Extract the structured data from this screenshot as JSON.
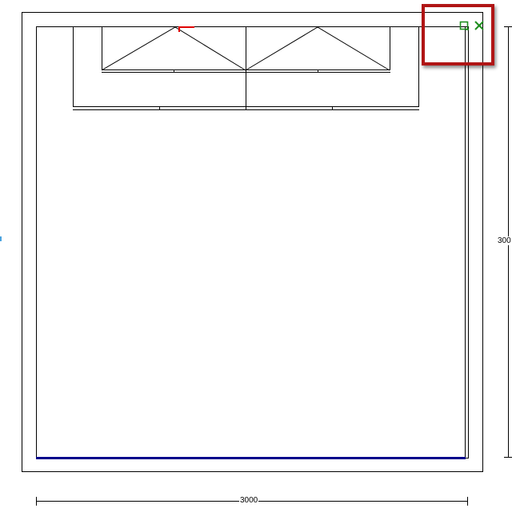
{
  "drawing": {
    "dimension_bottom": "3000",
    "dimension_right": "300"
  },
  "toolbar": {
    "icons": [
      "select-box-icon",
      "close-x-icon"
    ]
  },
  "colors": {
    "highlight": "#b01515",
    "floor_wall": "#00008b",
    "tool_icon": "#1e8e1e",
    "origin_marker": "#e00000",
    "lines": "#000000"
  }
}
